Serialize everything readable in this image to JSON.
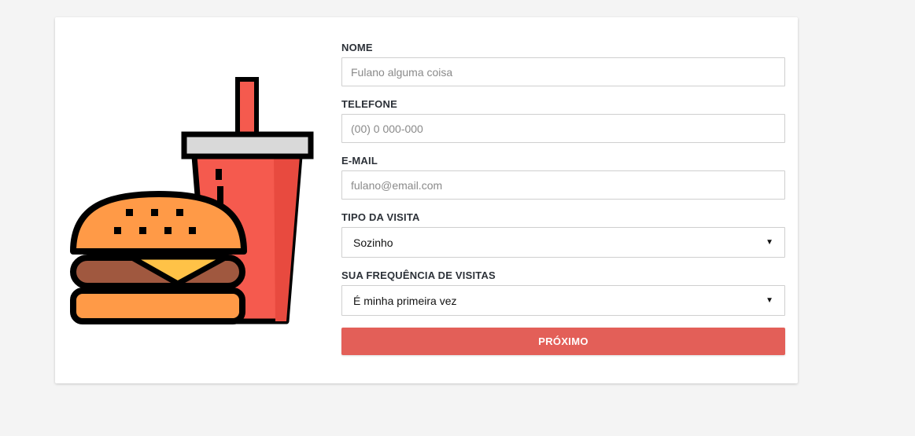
{
  "form": {
    "nome": {
      "label": "NOME",
      "placeholder": "Fulano alguma coisa"
    },
    "telefone": {
      "label": "TELEFONE",
      "placeholder": "(00) 0 000-000"
    },
    "email": {
      "label": "E-MAIL",
      "placeholder": "fulano@email.com"
    },
    "tipo_visita": {
      "label": "TIPO DA VISITA",
      "selected": "Sozinho"
    },
    "frequencia": {
      "label": "SUA FREQUÊNCIA DE VISITAS",
      "selected": "É minha primeira vez"
    },
    "submit_label": "PRÓXIMO"
  },
  "illustration": {
    "icon": "burger-and-soda-icon"
  },
  "colors": {
    "accent": "#e35f58",
    "background": "#f4f4f4",
    "card": "#ffffff",
    "cup": "#f55a4e",
    "bun": "#ff9a47",
    "patty": "#a0583f",
    "cheese": "#ffc247"
  }
}
